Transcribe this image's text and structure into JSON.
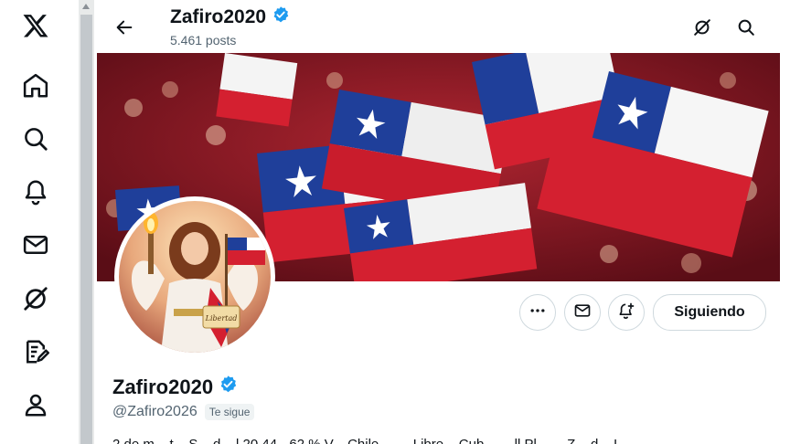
{
  "header": {
    "display_name": "Zafiro2020",
    "posts_count": "5.461 posts"
  },
  "profile": {
    "display_name": "Zafiro2020",
    "handle": "@Zafiro2026",
    "follows_you": "Te sigue",
    "bio_partial": "2 de m... t... S... d... l 20 44 - 62 % V... Chile ... ... Libre... Cub... ... ll Pl... ... Z... d... I..."
  },
  "actions": {
    "following_label": "Siguiendo"
  },
  "avatar_banner_text": "Libertad",
  "colors": {
    "verified": "#1d9bf0",
    "text": "#0f1419",
    "secondary": "#536471",
    "border": "#cfd9de"
  },
  "icons": {
    "nav": [
      "x-logo-icon",
      "home-icon",
      "search-icon",
      "notifications-icon",
      "messages-icon",
      "grok-icon",
      "post-compose-icon",
      "profile-icon"
    ],
    "header": [
      "back-arrow-icon",
      "grok-icon",
      "search-icon"
    ],
    "actions": [
      "more-icon",
      "message-icon",
      "notifications-add-icon"
    ]
  }
}
